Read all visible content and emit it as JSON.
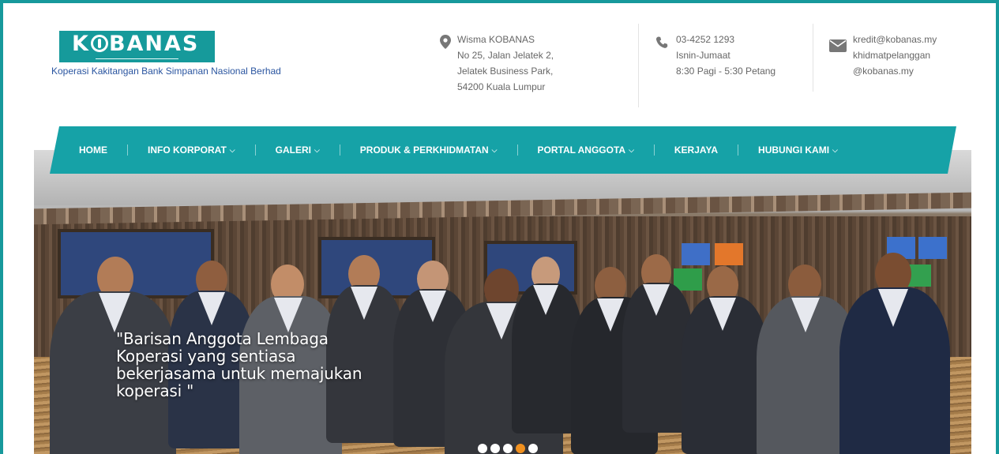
{
  "header": {
    "logo_text_before": "K",
    "logo_text_after": "BANAS",
    "org_name": "Koperasi Kakitangan Bank Simpanan Nasional Berhad",
    "address": {
      "icon": "map-pin-icon",
      "line1": "Wisma KOBANAS",
      "line2": "No 25, Jalan Jelatek 2,",
      "line3": "Jelatek Business Park,",
      "line4": "54200 Kuala Lumpur"
    },
    "phone": {
      "icon": "phone-icon",
      "line1": "03-4252 1293",
      "line2": "Isnin-Jumaat",
      "line3": "8:30 Pagi - 5:30 Petang"
    },
    "email": {
      "icon": "envelope-icon",
      "line1": "kredit@kobanas.my",
      "line2": "khidmatpelanggan",
      "line3": "@kobanas.my"
    }
  },
  "nav": {
    "items": [
      {
        "label": "HOME",
        "has_dropdown": false
      },
      {
        "label": "INFO KORPORAT",
        "has_dropdown": true
      },
      {
        "label": "GALERI",
        "has_dropdown": true
      },
      {
        "label": "PRODUK & PERKHIDMATAN",
        "has_dropdown": true
      },
      {
        "label": "PORTAL ANGGOTA",
        "has_dropdown": true
      },
      {
        "label": "KERJAYA",
        "has_dropdown": false
      },
      {
        "label": "HUBUNGI KAMI",
        "has_dropdown": true
      }
    ],
    "dropdown_glyph": "⌵"
  },
  "hero": {
    "caption": "\"Barisan Anggota Lembaga Koperasi yang sentiasa bekerjasama untuk memajukan koperasi \"",
    "slides": 5,
    "active_slide": 4
  },
  "colors": {
    "brand_teal": "#16a2a7",
    "frame": "#17999c",
    "link_blue": "#2a55a0",
    "active_dot": "#f0901f"
  }
}
